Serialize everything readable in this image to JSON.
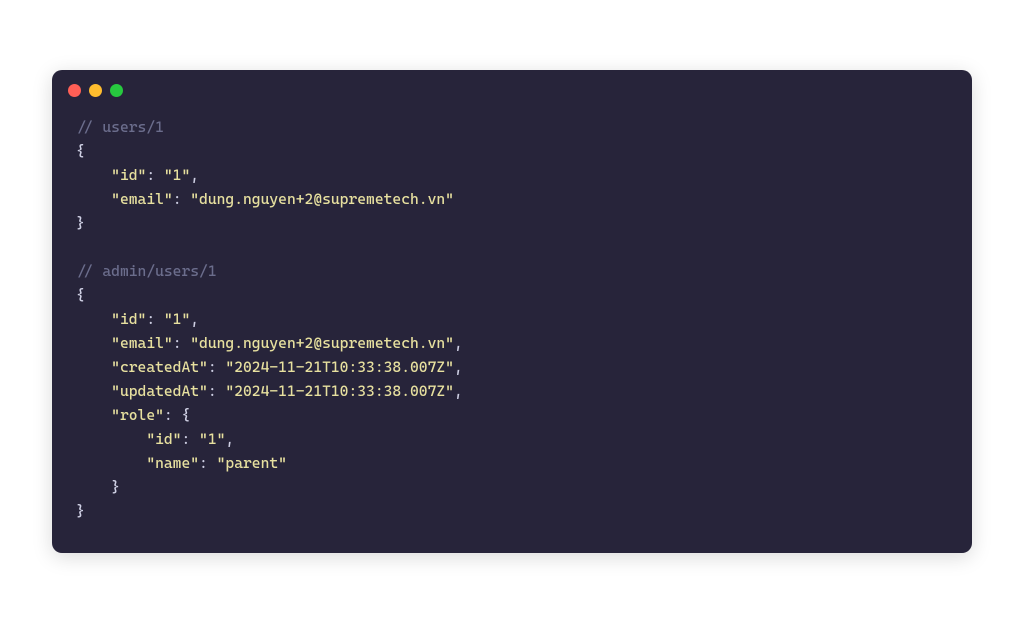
{
  "window": {
    "comment1": "// users/1",
    "comment2": "// admin/users/1",
    "block1": {
      "id_key": "\"id\"",
      "id_val": "\"1\"",
      "email_key": "\"email\"",
      "email_val": "\"dung.nguyen+2@supremetech.vn\""
    },
    "block2": {
      "id_key": "\"id\"",
      "id_val": "\"1\"",
      "email_key": "\"email\"",
      "email_val": "\"dung.nguyen+2@supremetech.vn\"",
      "createdAt_key": "\"createdAt\"",
      "createdAt_val": "\"2024-11-21T10:33:38.007Z\"",
      "updatedAt_key": "\"updatedAt\"",
      "updatedAt_val": "\"2024-11-21T10:33:38.007Z\"",
      "role_key": "\"role\"",
      "role_id_key": "\"id\"",
      "role_id_val": "\"1\"",
      "role_name_key": "\"name\"",
      "role_name_val": "\"parent\""
    },
    "braces": {
      "open": "{",
      "close": "}",
      "colon": ": ",
      "comma": ","
    }
  }
}
